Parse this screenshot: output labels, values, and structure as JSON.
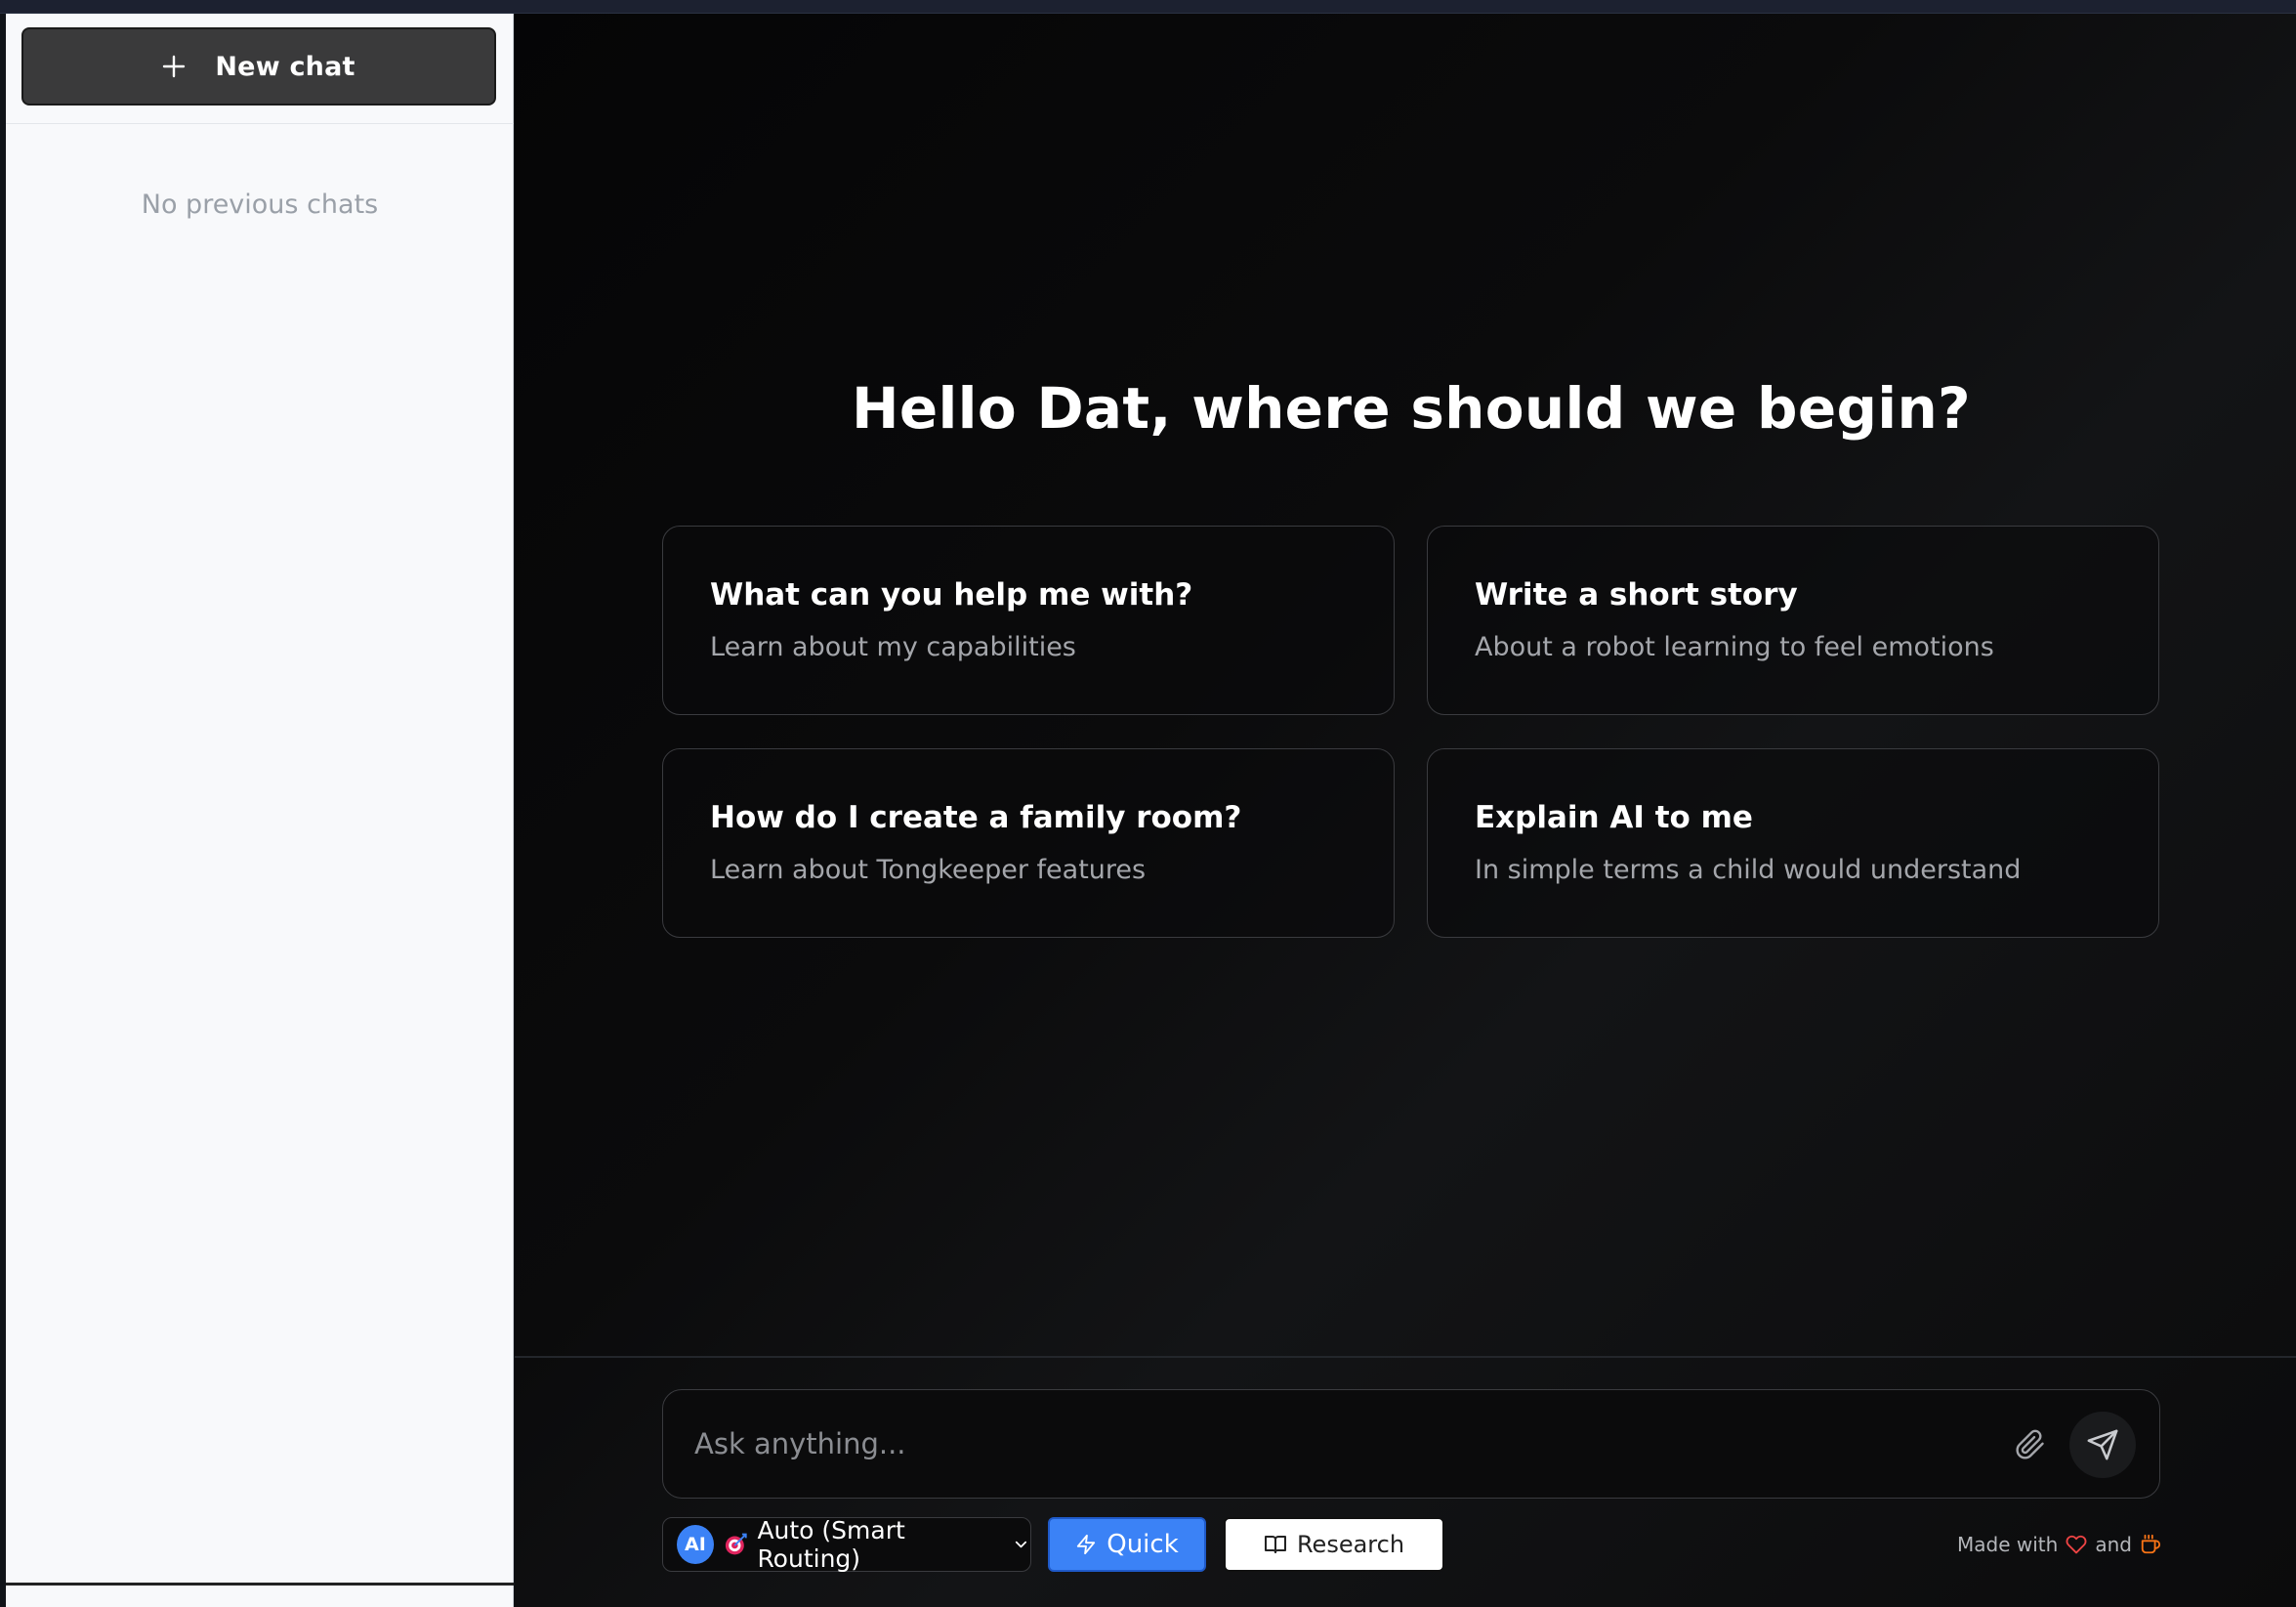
{
  "sidebar": {
    "new_chat_label": "New chat",
    "empty_text": "No previous chats"
  },
  "main": {
    "greeting": "Hello Dat, where should we begin?",
    "suggestions": [
      {
        "title": "What can you help me with?",
        "subtitle": "Learn about my capabilities"
      },
      {
        "title": "Write a short story",
        "subtitle": "About a robot learning to feel emotions"
      },
      {
        "title": "How do I create a family room?",
        "subtitle": "Learn about Tongkeeper features"
      },
      {
        "title": "Explain AI to me",
        "subtitle": "In simple terms a child would understand"
      }
    ]
  },
  "composer": {
    "placeholder": "Ask anything...",
    "model_badge": "AI",
    "model_label": "Auto (Smart Routing)",
    "quick_label": "Quick",
    "research_label": "Research",
    "made_with_label": "Made with",
    "and_label": "and"
  },
  "colors": {
    "accent": "#3b82f6",
    "heart": "#ef4444",
    "coffee": "#f97316"
  },
  "icons": [
    "plus-icon",
    "paperclip-icon",
    "send-icon",
    "target-icon",
    "chevron-down-icon",
    "lightning-icon",
    "book-icon",
    "heart-icon",
    "coffee-icon"
  ]
}
